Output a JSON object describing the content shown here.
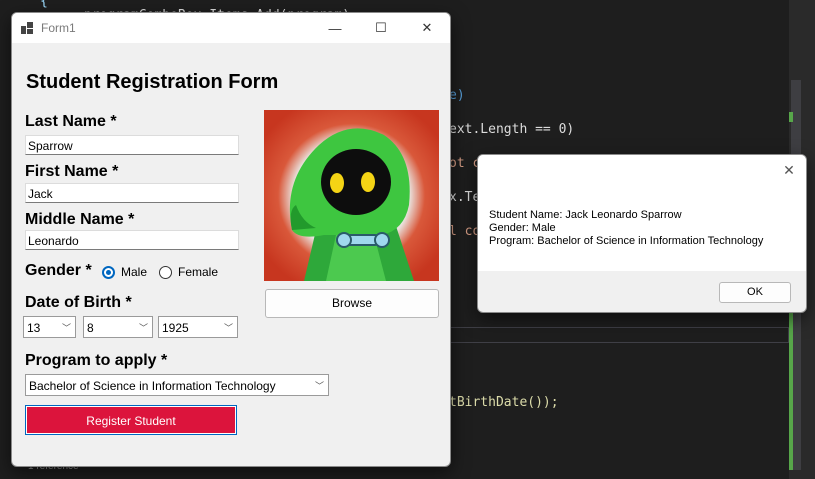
{
  "editor": {
    "lines": [
      {
        "before": "",
        "kw": "",
        "text": "programComboBox.Items.Add(program);",
        "after": ""
      },
      {
        "text": "e)"
      },
      {
        "text": "ext.Length == 0)"
      },
      {
        "text": "ot c"
      },
      {
        "text": "x.Te"
      },
      {
        "text": "l co"
      },
      {
        "text": "tBirthDate());"
      }
    ],
    "reference_label": "1 reference"
  },
  "form": {
    "window_title": "Form1",
    "controls": {
      "minimize": "—",
      "maximize": "☐",
      "close": "✕"
    },
    "heading": "Student Registration Form",
    "last_name_label": "Last Name *",
    "last_name_value": "Sparrow",
    "first_name_label": "First Name *",
    "first_name_value": "Jack",
    "middle_name_label": "Middle Name *",
    "middle_name_value": "Leonardo",
    "gender_label": "Gender *",
    "gender_options": [
      "Male",
      "Female"
    ],
    "gender_selected": "Male",
    "dob_label": "Date of Birth *",
    "dob_day": "13",
    "dob_month": "8",
    "dob_year": "1925",
    "program_label": "Program to apply *",
    "program_value": "Bachelor of Science in Information Technology",
    "browse_label": "Browse",
    "register_label": "Register Student",
    "colors": {
      "register_bg": "#dc143c",
      "accent": "#0067c0"
    }
  },
  "message_box": {
    "close": "✕",
    "lines": [
      "Student Name: Jack Leonardo Sparrow",
      "Gender: Male",
      "Program: Bachelor of Science in Information Technology"
    ],
    "ok_label": "OK"
  }
}
